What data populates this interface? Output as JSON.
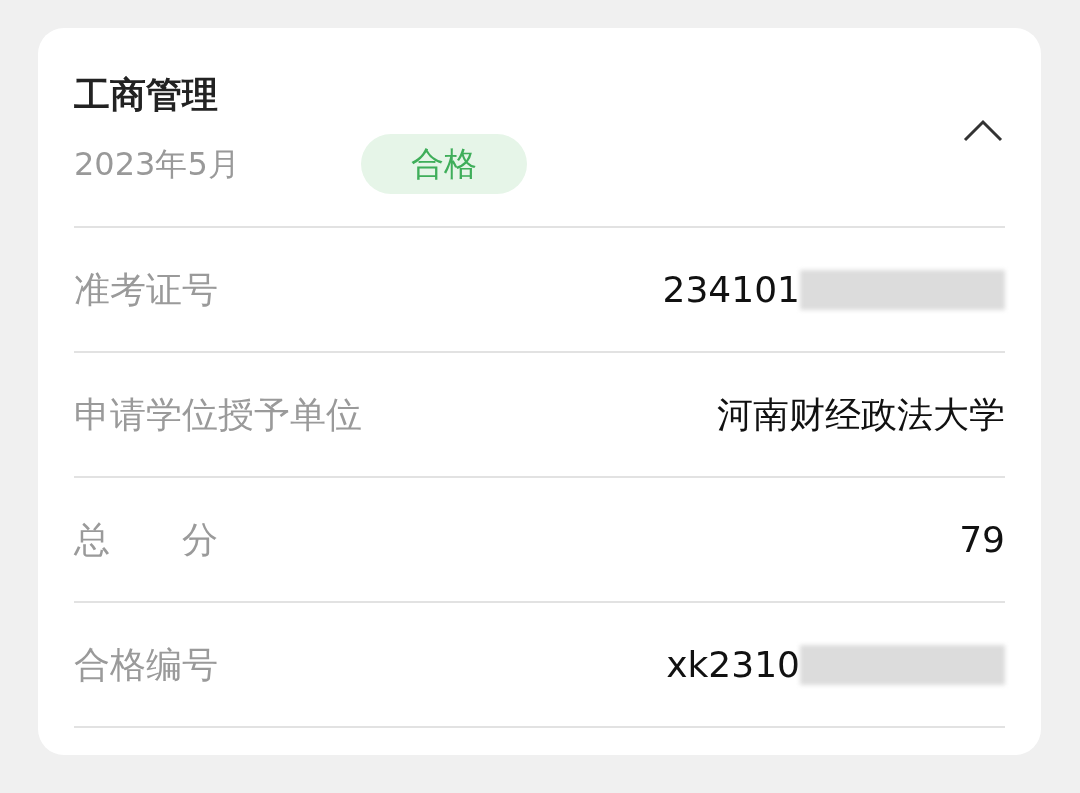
{
  "card": {
    "title": "工商管理",
    "date": "2023年5月",
    "badge": "合格",
    "expanded": true,
    "rows": [
      {
        "label": "准考证号",
        "value": "234101",
        "redacted": true
      },
      {
        "label": "申请学位授予单位",
        "value": "河南财经政法大学",
        "redacted": false
      },
      {
        "label": "总　　分",
        "value": "79",
        "redacted": false
      },
      {
        "label": "合格编号",
        "value": "xk2310",
        "redacted": true
      }
    ]
  }
}
